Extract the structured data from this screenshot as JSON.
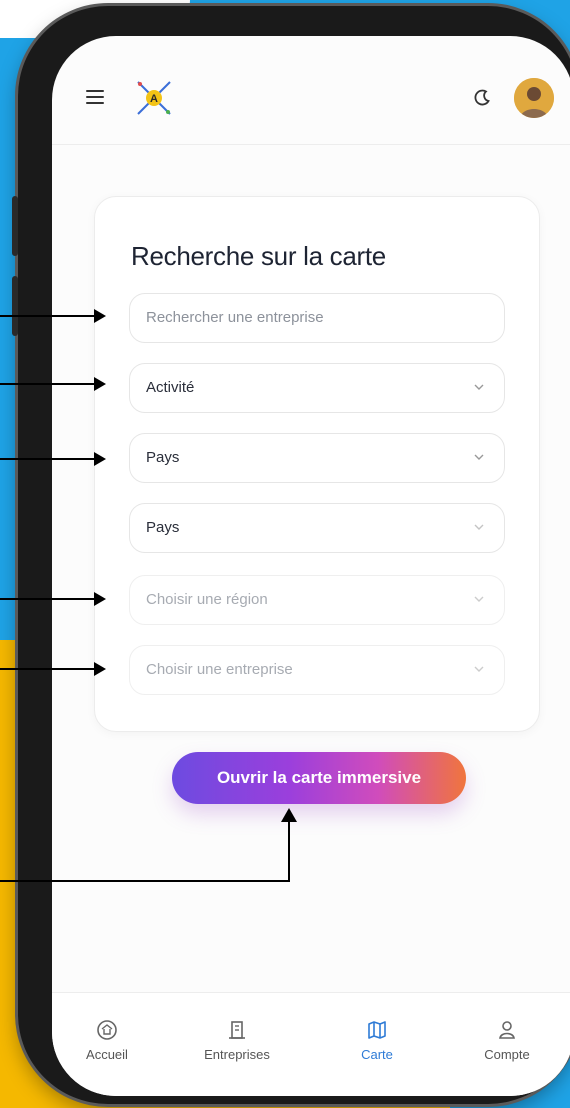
{
  "header": {
    "menu_icon": "hamburger-menu-icon",
    "logo_icon": "logo-icon",
    "theme_icon": "moon-icon",
    "avatar_icon": "user-avatar"
  },
  "search_card": {
    "title": "Recherche sur la carte",
    "search_placeholder": "Rechercher une entreprise",
    "activity_value": "Activité",
    "country1_value": "Pays",
    "country2_value": "Pays",
    "region_placeholder": "Choisir une région",
    "company_placeholder": "Choisir une entreprise"
  },
  "cta": {
    "label": "Ouvrir la carte immersive"
  },
  "bottom_nav": {
    "items": [
      {
        "label": "Accueil",
        "icon": "home-icon"
      },
      {
        "label": "Entreprises",
        "icon": "building-icon"
      },
      {
        "label": "Carte",
        "icon": "map-icon",
        "active": true
      },
      {
        "label": "Compte",
        "icon": "user-icon"
      }
    ]
  },
  "colors": {
    "background_blue": "#1FA3E6",
    "background_yellow": "#F5B800",
    "active_nav": "#2E7BD6",
    "cta_gradient_start": "#6D4BE0",
    "cta_gradient_end": "#F0753D"
  }
}
